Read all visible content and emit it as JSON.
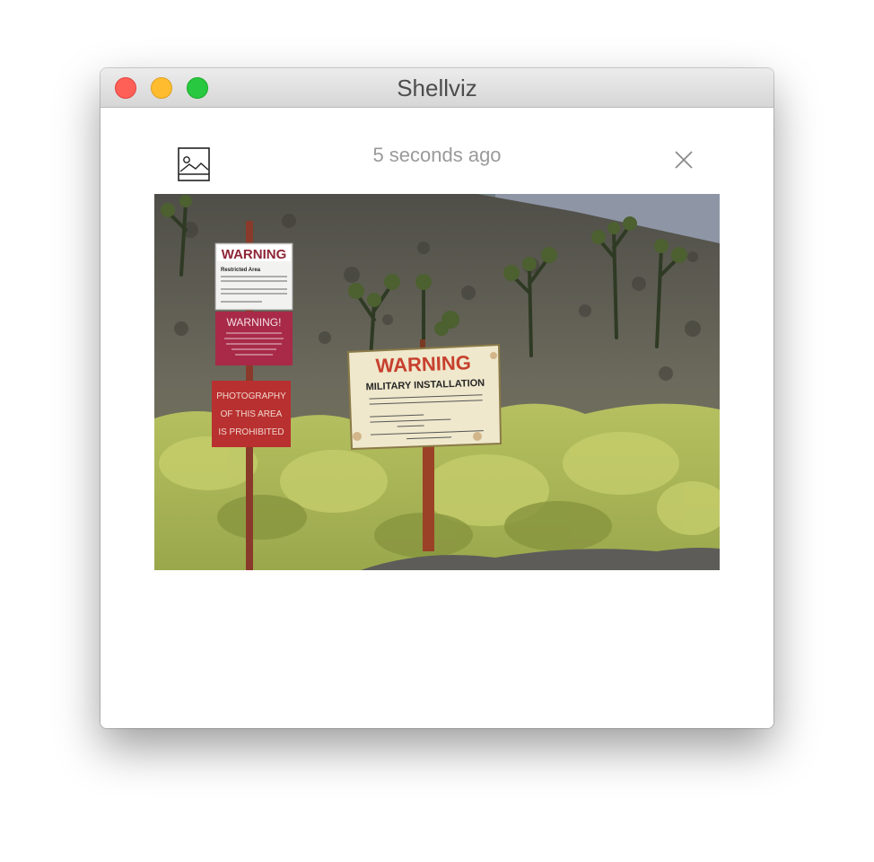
{
  "window": {
    "title": "Shellviz"
  },
  "entry": {
    "timestamp": "5 seconds ago",
    "type_icon": "image-icon",
    "close_icon": "close-icon"
  },
  "photo": {
    "signs": {
      "left_top_heading": "WARNING",
      "left_top_subheading": "Restricted Area",
      "left_middle_heading": "WARNING!",
      "left_bottom_line1": "PHOTOGRAPHY",
      "left_bottom_line2": "OF THIS AREA",
      "left_bottom_line3": "IS PROHIBITED",
      "right_heading": "WARNING",
      "right_subheading": "MILITARY INSTALLATION"
    }
  },
  "colors": {
    "close_light": "#fe5f57",
    "minimize_light": "#febc2e",
    "maximize_light": "#28c840",
    "sign_red": "#b8302f",
    "sign_magenta": "#a82a48"
  }
}
